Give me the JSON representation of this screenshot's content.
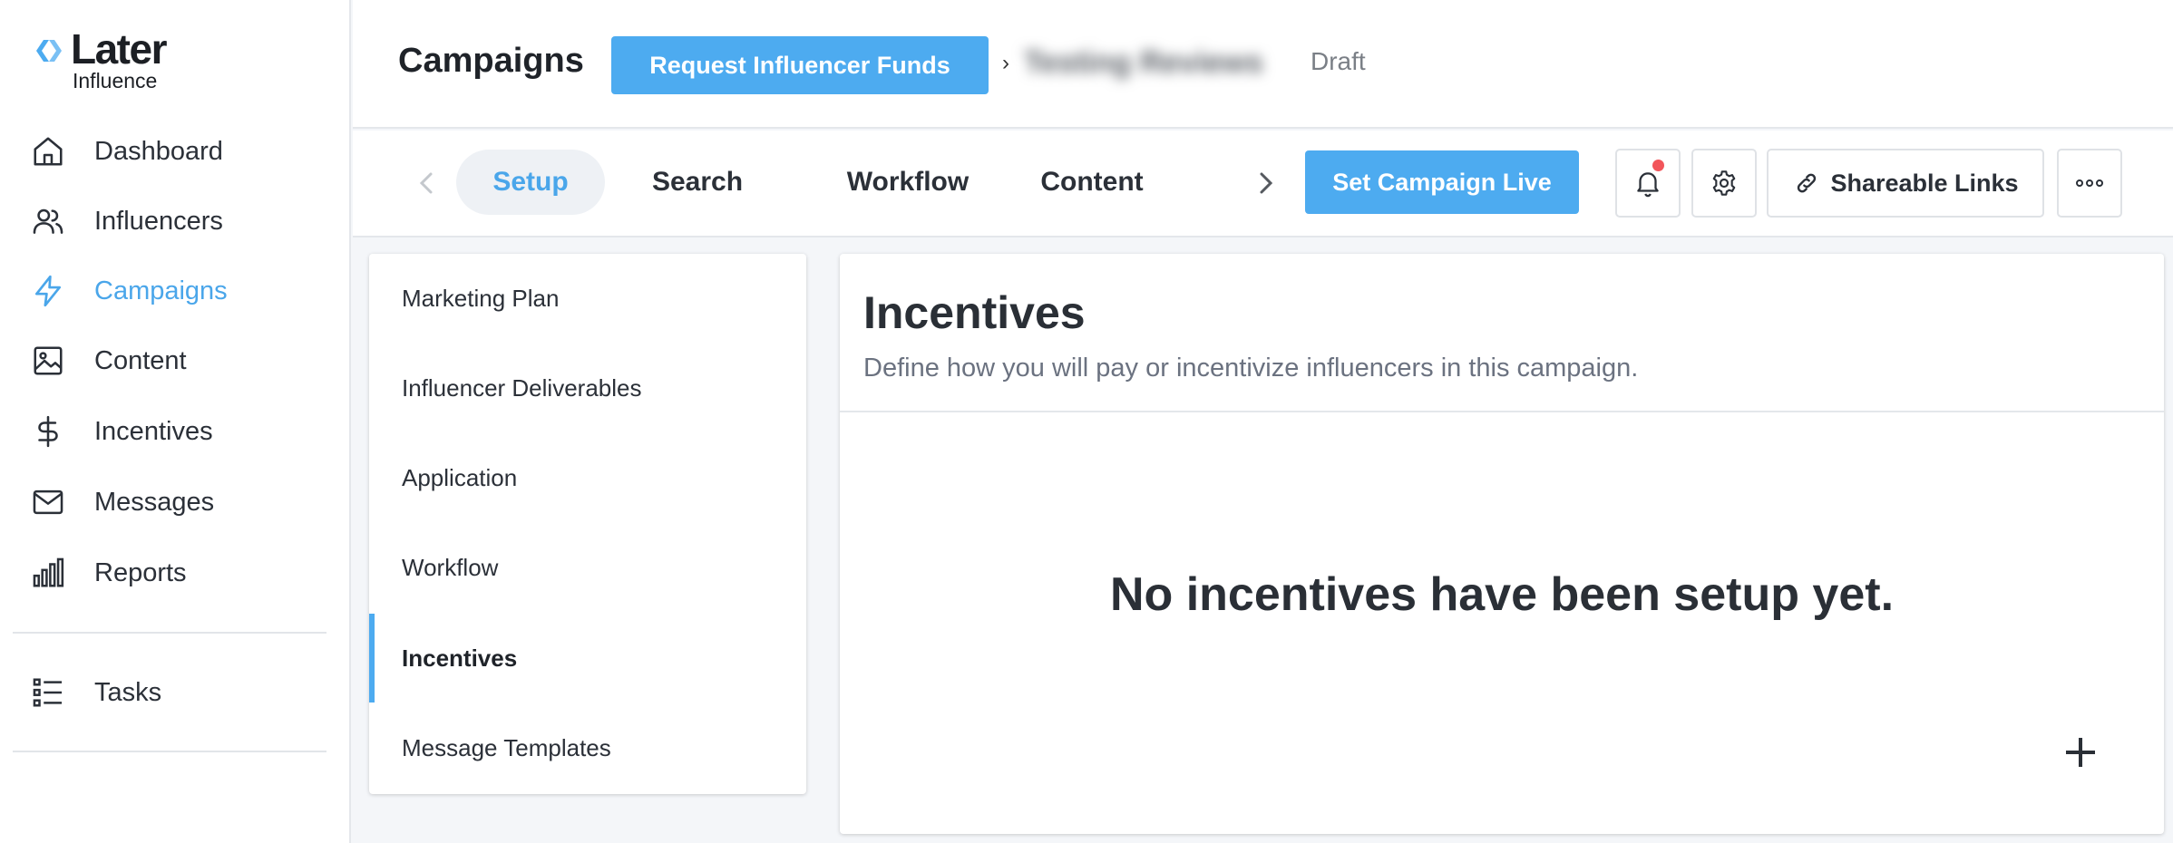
{
  "brand": {
    "name": "Later",
    "sub": "Influence"
  },
  "sidebar": {
    "items": [
      {
        "label": "Dashboard",
        "icon": "home-icon"
      },
      {
        "label": "Influencers",
        "icon": "users-icon"
      },
      {
        "label": "Campaigns",
        "icon": "lightning-icon",
        "active": true
      },
      {
        "label": "Content",
        "icon": "image-icon"
      },
      {
        "label": "Incentives",
        "icon": "dollar-icon"
      },
      {
        "label": "Messages",
        "icon": "mail-icon"
      },
      {
        "label": "Reports",
        "icon": "bar-chart-icon"
      }
    ],
    "secondary": [
      {
        "label": "Tasks",
        "icon": "list-icon"
      }
    ]
  },
  "header": {
    "title": "Campaigns",
    "request_funds_label": "Request Influencer Funds",
    "breadcrumb_separator": "›",
    "campaign_name": "Testing Reviews",
    "campaign_status": "Draft"
  },
  "tabs": {
    "items": [
      "Setup",
      "Search",
      "Workflow",
      "Content"
    ],
    "active": "Setup",
    "set_live_label": "Set Campaign Live",
    "shareable_links_label": "Shareable Links"
  },
  "subnav": {
    "items": [
      "Marketing Plan",
      "Influencer Deliverables",
      "Application",
      "Workflow",
      "Incentives",
      "Message Templates"
    ],
    "active": "Incentives"
  },
  "panel": {
    "title": "Incentives",
    "description": "Define how you will pay or incentivize influencers in this campaign.",
    "empty_message": "No incentives have been setup yet."
  },
  "colors": {
    "accent": "#4dabf0",
    "active_text": "#4aa6ea",
    "notification": "#f2555a"
  }
}
